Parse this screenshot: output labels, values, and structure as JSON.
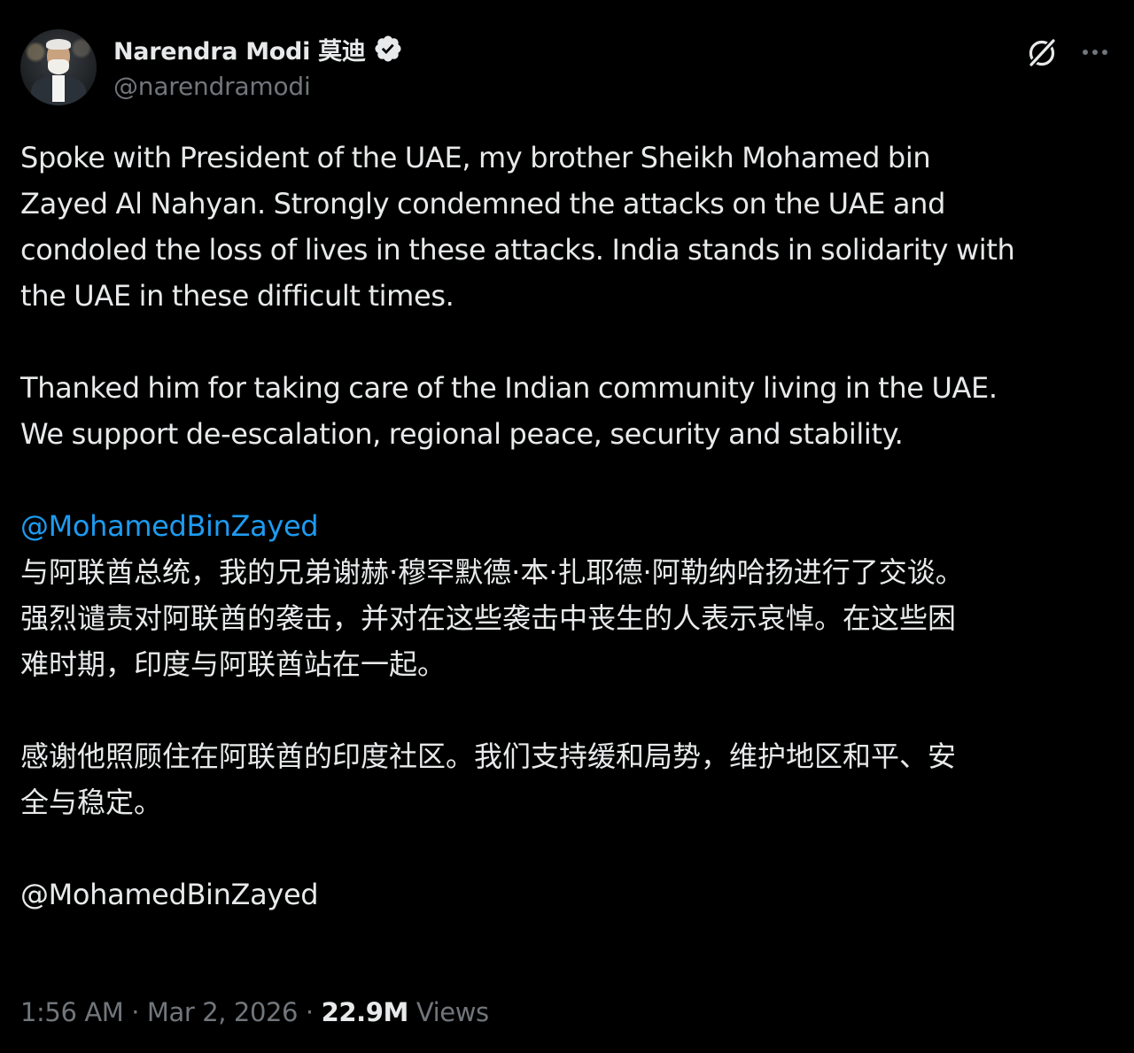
{
  "author": {
    "display_name": "Narendra Modi 莫迪",
    "handle": "@narendramodi",
    "verified": true,
    "avatar_icon": "profile-photo"
  },
  "header_actions": {
    "grok_icon": "grok-slash-icon",
    "more_icon": "more-horizontal-icon"
  },
  "tweet": {
    "para1": "Spoke with President of the UAE, my brother Sheikh Mohamed bin\nZayed Al Nahyan. Strongly condemned the attacks on the UAE and\ncondoled the loss of lives in these attacks. India stands in solidarity with\nthe UAE in these difficult times.",
    "para2": "Thanked him for taking care of the Indian community living in the UAE.\nWe support de-escalation, regional peace, security and stability.",
    "mention1": "@MohamedBinZayed",
    "para3_zh": "与阿联酋总统，我的兄弟谢赫·穆罕默德·本·扎耶德·阿勒纳哈扬进行了交谈。\n强烈谴责对阿联酋的袭击，并对在这些袭击中丧生的人表示哀悼。在这些困\n难时期，印度与阿联酋站在一起。",
    "para4_zh": "感谢他照顾住在阿联酋的印度社区。我们支持缓和局势，维护地区和平、安\n全与稳定。",
    "mention2": "@MohamedBinZayed"
  },
  "meta": {
    "time": "1:56 AM",
    "separator": " · ",
    "date": "Mar 2, 2026",
    "views_count": "22.9M",
    "views_label": "Views"
  },
  "colors": {
    "background": "#000000",
    "text": "#e7e9ea",
    "secondary": "#71767b",
    "link": "#1d9bf0",
    "verified_badge": "#e7e9ea"
  }
}
